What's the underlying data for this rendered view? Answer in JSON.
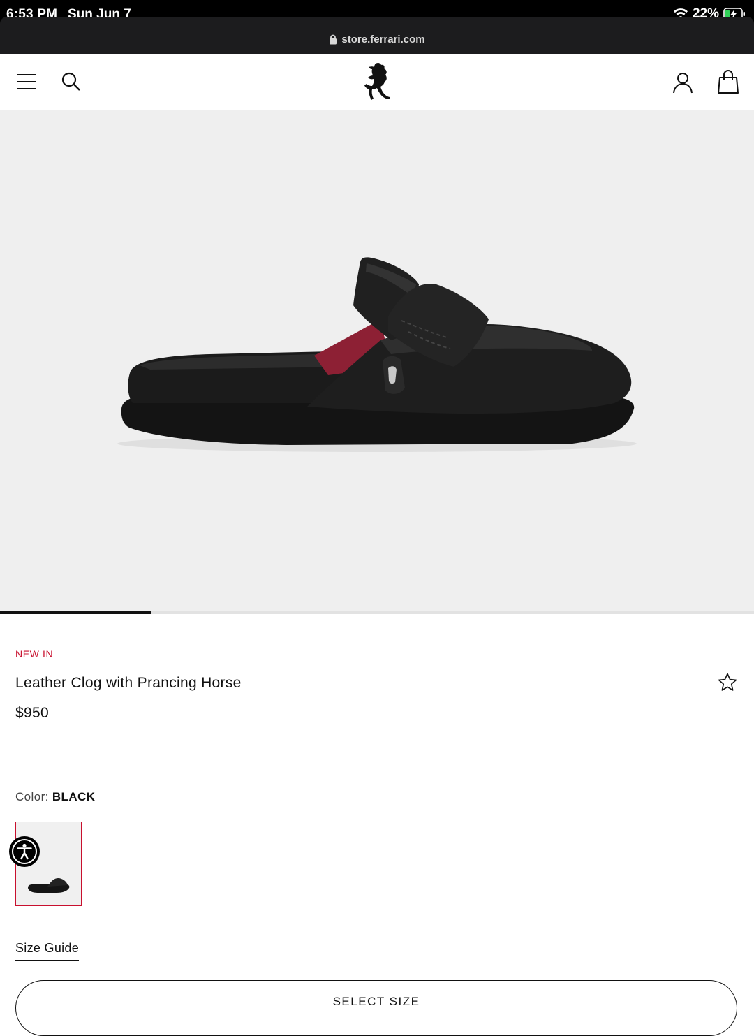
{
  "status_bar": {
    "time": "6:53 PM",
    "date": "Sun Jun 7",
    "battery": "22%"
  },
  "browser": {
    "url": "store.ferrari.com"
  },
  "nav": {
    "menu_icon": "hamburger-menu-icon",
    "search_icon": "search-icon",
    "logo": "prancing-horse-logo",
    "account_icon": "account-icon",
    "bag_icon": "shopping-bag-icon"
  },
  "gallery": {
    "image_count": 5,
    "current_index": 1,
    "progress_fraction": 0.2
  },
  "product": {
    "badge": "NEW IN",
    "name": "Leather Clog with Prancing Horse",
    "price": "$950",
    "color_label": "Color:",
    "color_value": "BLACK",
    "size_guide": "Size Guide",
    "select_size": "SELECT SIZE"
  },
  "colors": {
    "accent": "#c8102e",
    "hero_bg": "#efefef",
    "text": "#111111"
  }
}
